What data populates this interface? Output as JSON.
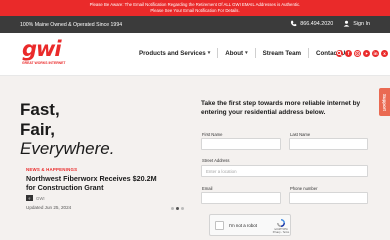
{
  "alert": {
    "text": "Please Be Aware: The Email Notification Regarding the Retirement Of ALL GWI EMAIL Addresses is Authentic. Please See Your Email Notification For Details."
  },
  "utility_bar": {
    "tagline": "100% Maine Owned & Operated Since 1994",
    "phone": "866.494.2020",
    "sign_in": "Sign In"
  },
  "logo": {
    "wordmark": "gwi",
    "tagline": "GREAT WORKS INTERNET"
  },
  "nav": {
    "items": [
      {
        "label": "Products and Services",
        "has_dropdown": true
      },
      {
        "label": "About",
        "has_dropdown": true
      },
      {
        "label": "Stream Team",
        "has_dropdown": false
      },
      {
        "label": "Contact Us",
        "has_dropdown": false
      }
    ],
    "socials": [
      "search-icon",
      "facebook-icon",
      "instagram-icon",
      "youtube-icon",
      "linkedin-icon",
      "x-icon"
    ]
  },
  "hero": {
    "headline_line1": "Fast,",
    "headline_line2": "Fair,",
    "headline_line3": "Everywhere.",
    "news": {
      "label": "NEWS & HAPPENINGS",
      "title": "Northwest Fiberworx Receives $20.2M for Construction Grant",
      "meta": "GWI",
      "date": "Updated Jun 25, 2024"
    },
    "carousel": {
      "count": 3,
      "active": 2
    }
  },
  "form": {
    "intro": "Take the first step towards more reliable internet by entering your residential address below.",
    "first_name": {
      "label": "First Name",
      "value": ""
    },
    "last_name": {
      "label": "Last Name",
      "value": ""
    },
    "street": {
      "label": "Street Address",
      "placeholder": "Enter a location"
    },
    "email": {
      "label": "Email",
      "value": ""
    },
    "phone": {
      "label": "Phone number",
      "value": ""
    },
    "captcha": {
      "label": "I'm not a robot",
      "brand": "reCAPTCHA",
      "links": "Privacy - Terms"
    }
  },
  "support": {
    "label": "Support"
  },
  "colors": {
    "brand": "#ea2a2a",
    "utility_bg": "#3b3b3b",
    "hero_bg": "#f4f1ef"
  }
}
